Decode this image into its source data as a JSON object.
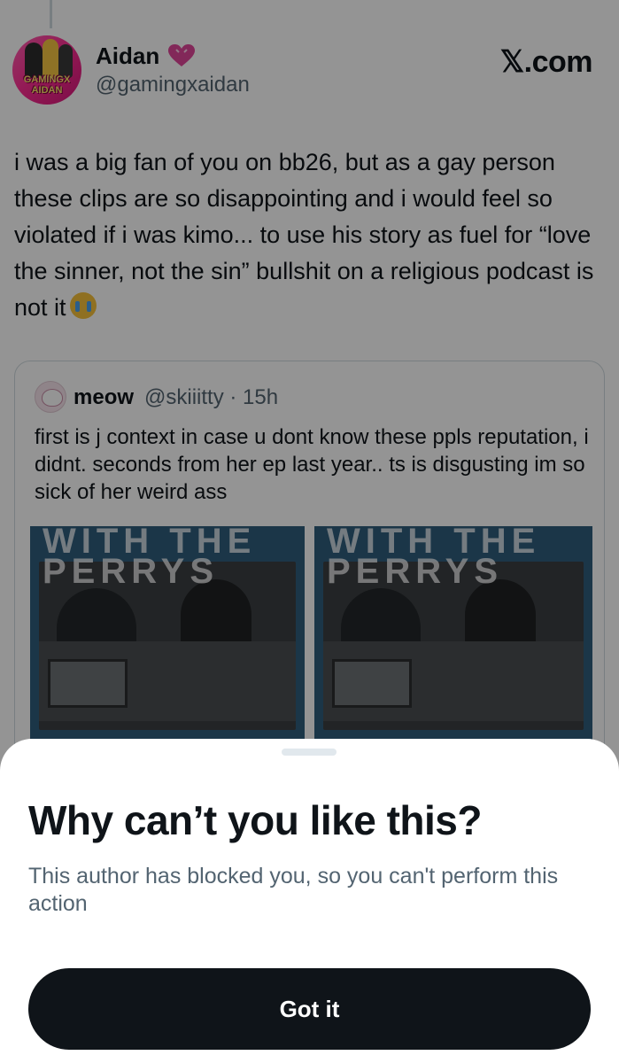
{
  "tweet": {
    "author_name": "Aidan",
    "author_handle": "@gamingxaidan",
    "avatar_text": "GAMINGX AIDAN",
    "watermark": "𝕏.com",
    "text": "i was a big fan of you on bb26, but as a gay person these clips are so disappointing and i would feel so violated if i was kimo... to use his story as fuel for “love the sinner, not the sin” bullshit on a religious podcast is not it",
    "emoji_icon": "loudly-crying-face-icon",
    "heart_icon": "pink-heart-icon"
  },
  "quoted": {
    "author_name": "meow",
    "handle_time": "@skiiitty · 15h",
    "text": "first is j context in case u dont know these ppls reputation, i didnt. seconds from her ep last year.. ts is disgusting im so sick of her weird ass",
    "media": [
      {
        "banner": "WITH THE PERRYS"
      },
      {
        "banner": "WITH THE PERRYS"
      }
    ]
  },
  "sheet": {
    "title": "Why can’t you like this?",
    "description": "This author has blocked you, so you can't perform this action",
    "button_label": "Got it"
  },
  "colors": {
    "primary_text": "#0f1419",
    "secondary_text": "#536471",
    "button_bg": "#0f1419",
    "avatar_pink": "#ff2f94"
  }
}
